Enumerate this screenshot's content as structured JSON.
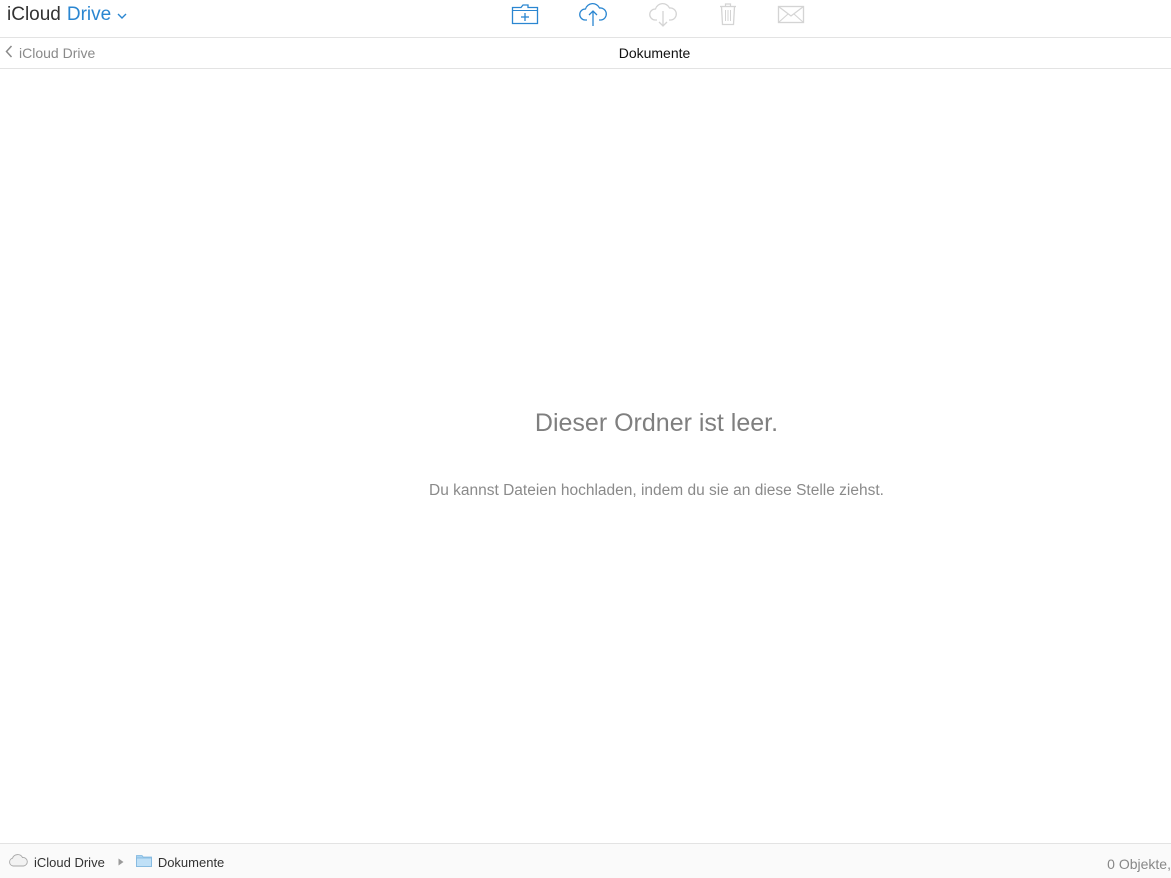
{
  "header": {
    "brand": "iCloud",
    "product": "Drive",
    "accent_color": "#2a86d1",
    "toolbar": [
      {
        "icon": "new-folder-icon",
        "enabled": true
      },
      {
        "icon": "upload-icon",
        "enabled": true
      },
      {
        "icon": "download-icon",
        "enabled": false
      },
      {
        "icon": "trash-icon",
        "enabled": false
      },
      {
        "icon": "mail-icon",
        "enabled": false
      }
    ]
  },
  "nav": {
    "back_label": "iCloud Drive",
    "title": "Dokumente"
  },
  "empty_state": {
    "heading": "Dieser Ordner ist leer.",
    "message": "Du kannst Dateien hochladen, indem du sie an diese Stelle ziehst."
  },
  "status": {
    "breadcrumb": [
      {
        "label": "iCloud Drive",
        "icon": "cloud-icon"
      },
      {
        "label": "Dokumente",
        "icon": "folder-icon"
      }
    ],
    "item_count": "0 Objekte,"
  }
}
